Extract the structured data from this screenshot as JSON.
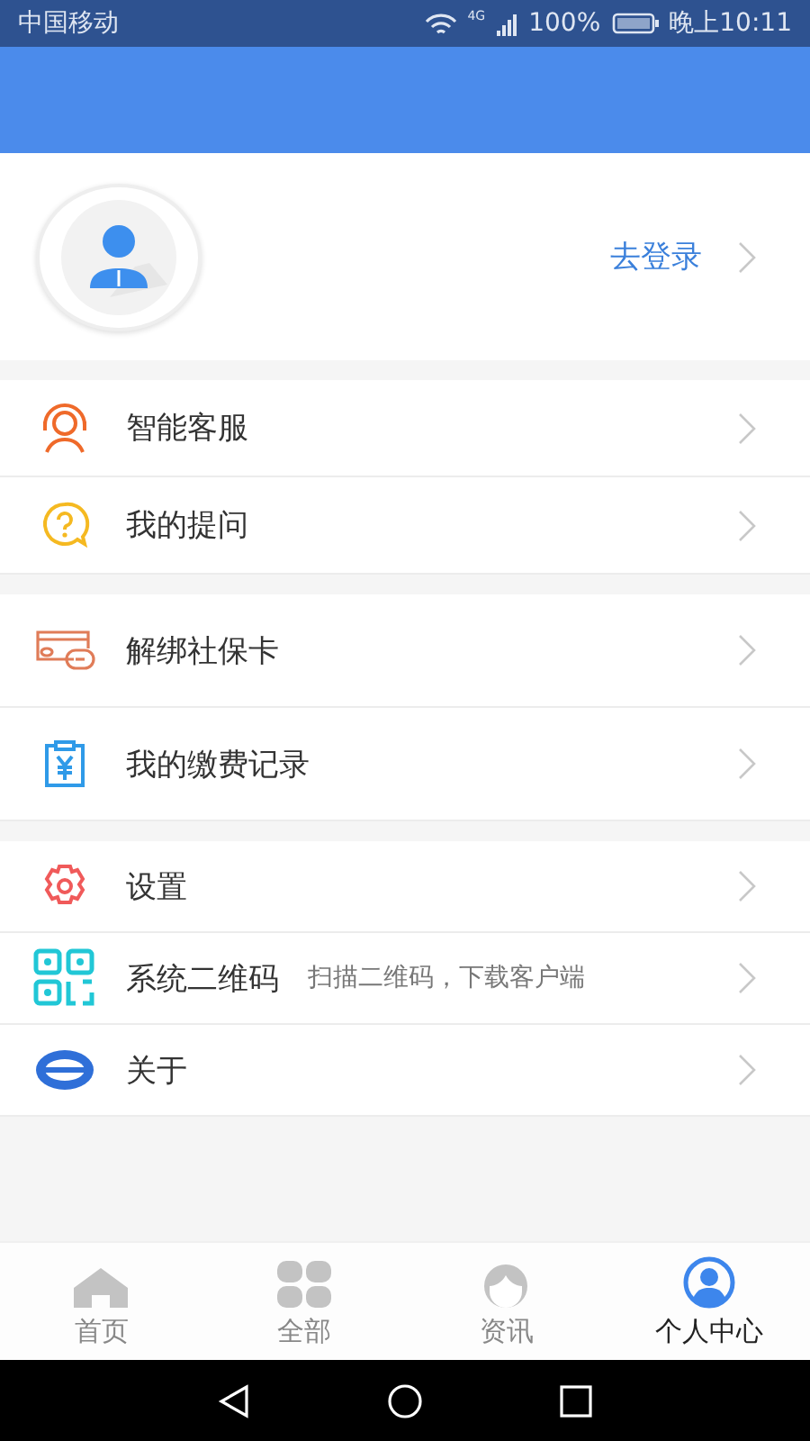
{
  "status_bar": {
    "carrier": "中国移动",
    "network": "4G",
    "battery": "100%",
    "time": "晚上10:11"
  },
  "profile": {
    "login_link": "去登录"
  },
  "menu_groups": [
    {
      "items": [
        {
          "kind": "service",
          "label": "智能客服"
        },
        {
          "kind": "question",
          "label": "我的提问"
        }
      ]
    },
    {
      "items": [
        {
          "kind": "card",
          "label": "解绑社保卡"
        },
        {
          "kind": "payment",
          "label": "我的缴费记录"
        }
      ]
    },
    {
      "items": [
        {
          "kind": "settings",
          "label": "设置"
        },
        {
          "kind": "qrcode",
          "label": "系统二维码",
          "hint": "扫描二维码，下载客户端"
        },
        {
          "kind": "about",
          "label": "关于"
        }
      ]
    }
  ],
  "tabs": [
    {
      "kind": "home",
      "label": "首页",
      "selected": false
    },
    {
      "kind": "all",
      "label": "全部",
      "selected": false
    },
    {
      "kind": "news",
      "label": "资讯",
      "selected": false
    },
    {
      "kind": "profile",
      "label": "个人中心",
      "selected": true
    }
  ]
}
